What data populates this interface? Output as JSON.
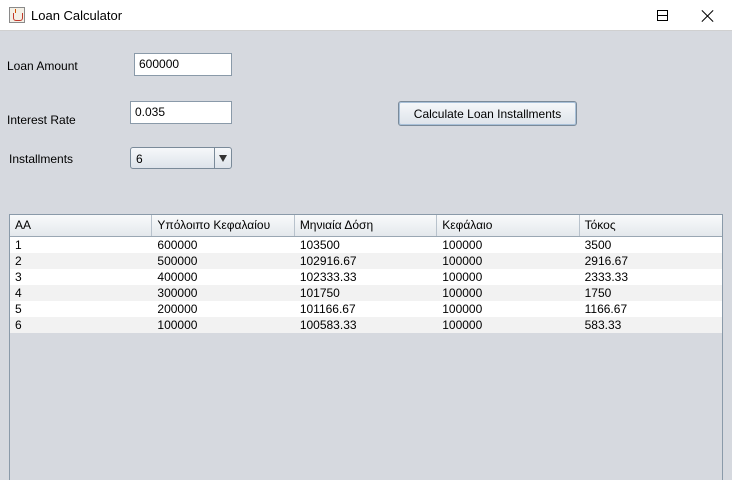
{
  "window": {
    "title": "Loan Calculator"
  },
  "form": {
    "loan_amount_label": "Loan Amount",
    "loan_amount_value": "600000",
    "interest_rate_label": "Interest Rate",
    "interest_rate_value": "0.035",
    "installments_label": "Installments",
    "installments_selected": "6",
    "calculate_button": "Calculate Loan Installments"
  },
  "table": {
    "headers": [
      "AA",
      "Υπόλοιπο Κεφαλαίου",
      "Μηνιαία Δόση",
      "Κεφάλαιο",
      "Τόκος"
    ],
    "rows": [
      [
        "1",
        "600000",
        "103500",
        "100000",
        "3500"
      ],
      [
        "2",
        "500000",
        "102916.67",
        "100000",
        "2916.67"
      ],
      [
        "3",
        "400000",
        "102333.33",
        "100000",
        "2333.33"
      ],
      [
        "4",
        "300000",
        "101750",
        "100000",
        "1750"
      ],
      [
        "5",
        "200000",
        "101166.67",
        "100000",
        "1166.67"
      ],
      [
        "6",
        "100000",
        "100583.33",
        "100000",
        "583.33"
      ]
    ]
  },
  "icons": {
    "app": "java-cup-icon",
    "minimize": "minimize-icon",
    "maximize": "maximize-icon",
    "close": "close-icon",
    "dropdown": "dropdown-arrow-icon"
  }
}
